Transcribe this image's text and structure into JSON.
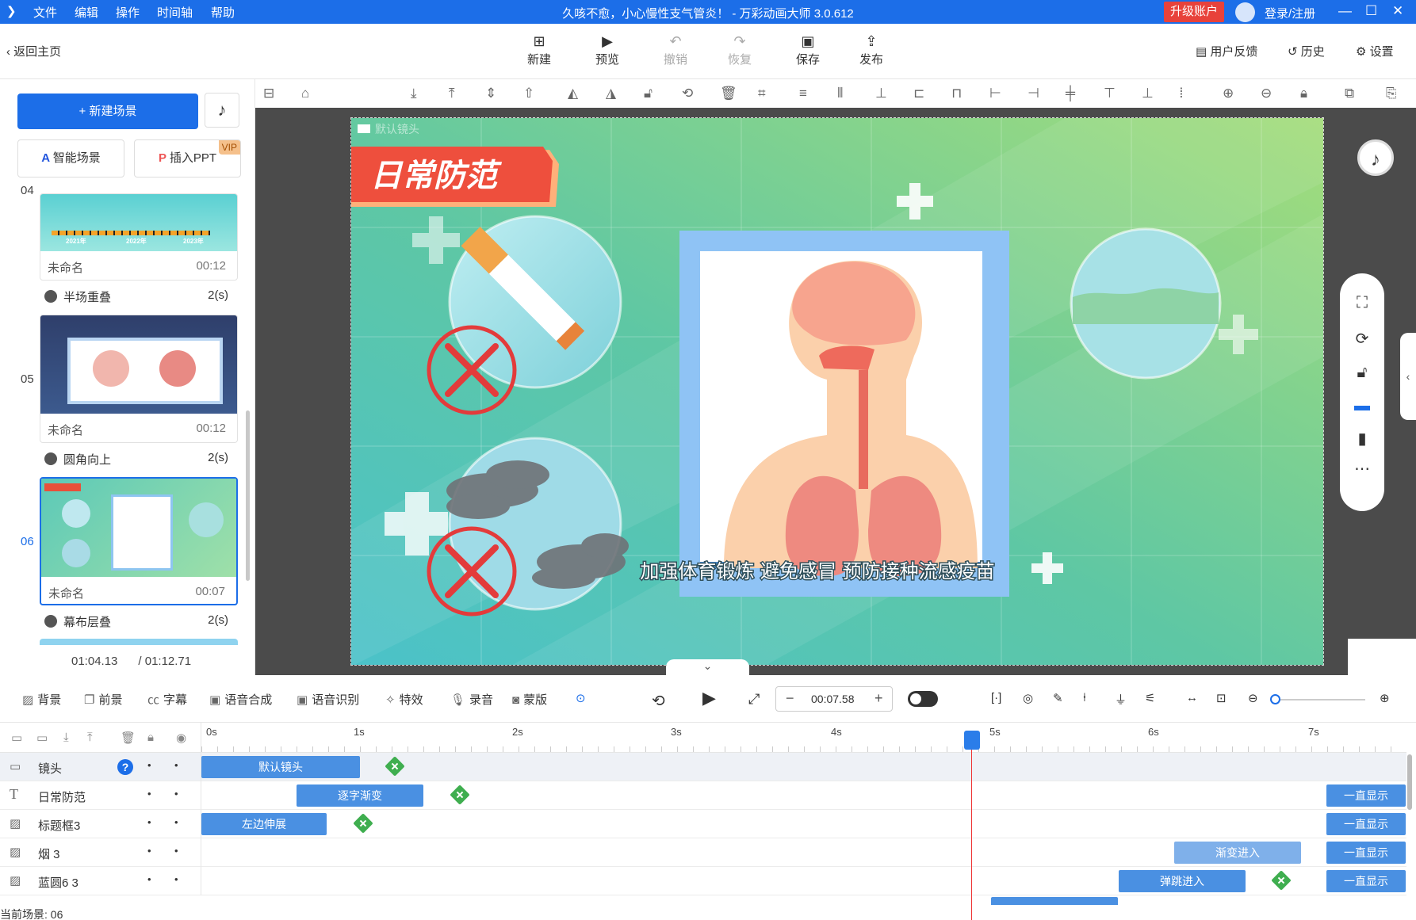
{
  "titlebar": {
    "menus": [
      "文件",
      "编辑",
      "操作",
      "时间轴",
      "帮助"
    ],
    "title": "久咳不愈，小心慢性支气管炎！ - 万彩动画大师 3.0.612",
    "upgrade": "升级账户",
    "login": "登录/注册"
  },
  "toolbar": {
    "back": "返回主页",
    "new": "新建",
    "preview": "预览",
    "undo": "撤销",
    "redo": "恢复",
    "save": "保存",
    "publish": "发布",
    "feedback": "用户反馈",
    "history": "历史",
    "settings": "设置"
  },
  "left": {
    "new_scene": "+ 新建场景",
    "smart_scene": "智能场景",
    "insert_ppt": "插入PPT",
    "vip": "VIP",
    "scenes": [
      {
        "num": "04",
        "name": "未命名",
        "time": "00:12",
        "years": [
          "2021年",
          "2022年",
          "2023年"
        ]
      },
      {
        "num": "05",
        "name": "未命名",
        "time": "00:12"
      },
      {
        "num": "06",
        "name": "未命名",
        "time": "00:07"
      }
    ],
    "transitions": [
      {
        "name": "半场重叠",
        "dur": "2(s)"
      },
      {
        "name": "圆角向上",
        "dur": "2(s)"
      },
      {
        "name": "幕布层叠",
        "dur": "2(s)"
      }
    ],
    "current_time": "01:04.13",
    "total_time": "/ 01:12.71"
  },
  "stage": {
    "camera_label": "默认镜头",
    "title": "日常防范",
    "caption": "加强体育锻炼 避免感冒 预防接种流感疫苗",
    "bg_color": "#5cc9a3"
  },
  "bottombar": {
    "items": [
      "背景",
      "前景",
      "字幕",
      "语音合成",
      "语音识别",
      "特效",
      "录音",
      "蒙版"
    ],
    "time": "00:07.58"
  },
  "timeline": {
    "ticks": [
      "0s",
      "1s",
      "2s",
      "3s",
      "4s",
      "5s",
      "6s",
      "7s"
    ],
    "rows": [
      {
        "icon": "camera",
        "name": "镜头",
        "clips": [
          {
            "label": "默认镜头"
          }
        ]
      },
      {
        "icon": "text",
        "name": "日常防范",
        "clips": [
          {
            "label": "逐字渐变"
          },
          {
            "label": "一直显示"
          }
        ]
      },
      {
        "icon": "image",
        "name": "标题框3",
        "clips": [
          {
            "label": "左边伸展"
          },
          {
            "label": "一直显示"
          }
        ]
      },
      {
        "icon": "image",
        "name": "烟 3",
        "clips": [
          {
            "label": "渐变进入"
          },
          {
            "label": "一直显示"
          }
        ]
      },
      {
        "icon": "image",
        "name": "蓝圆6 3",
        "clips": [
          {
            "label": "弹跳进入"
          },
          {
            "label": "一直显示"
          }
        ]
      }
    ],
    "current_scene": "当前场景: 06",
    "help": "?"
  }
}
